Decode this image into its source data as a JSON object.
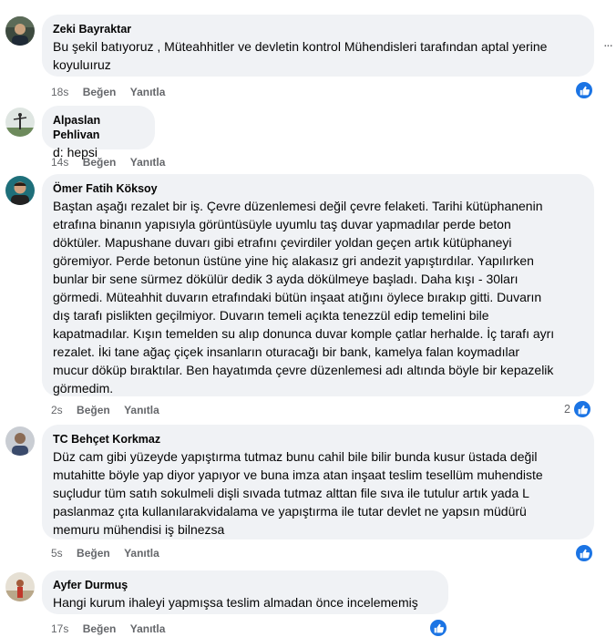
{
  "comments": [
    {
      "author": "Zeki Bayraktar",
      "lines": [
        "Bu şekil batıyoruz , Müteahhitler ve devletin kontrol Mühendisleri tarafından aptal yerine",
        "koyuluıruz"
      ],
      "time": "18s",
      "like_label": "Beğen",
      "reply_label": "Yanıtla",
      "reaction_count": ""
    },
    {
      "author": "Alpaslan Pehlivan",
      "lines": [
        "d: hepsi"
      ],
      "time": "14s",
      "like_label": "Beğen",
      "reply_label": "Yanıtla",
      "reaction_count": ""
    },
    {
      "author": "Ömer Fatih Köksoy",
      "lines": [
        "Baştan aşağı rezalet bir iş. Çevre düzenlemesi değil çevre felaketi. Tarihi kütüphanenin",
        "etrafına binanın yapısıyla görüntüsüyle uyumlu taş duvar yapmadılar perde beton",
        "döktüler. Mapushane duvarı gibi etrafını çevirdiler yoldan geçen artık kütüphaneyi",
        "göremiyor. Perde betonun üstüne yine hiç alakasız gri andezit yapıştırdılar. Yapılırken",
        "bunlar bir sene sürmez dökülür dedik 3 ayda dökülmeye başladı. Daha kışı - 30ları",
        "görmedi. Müteahhit duvarın etrafındaki bütün inşaat atığını öylece bırakıp gitti. Duvarın",
        "dış tarafı pislikten geçilmiyor. Duvarın temeli açıkta tenezzül edip temelini bile",
        "kapatmadılar. Kışın temelden su alıp donunca duvar komple çatlar herhalde. İç tarafı ayrı",
        "rezalet. İki tane ağaç çiçek insanların oturacağı bir bank, kamelya falan koymadılar",
        "mucur döküp bıraktılar. Ben hayatımda çevre düzenlemesi adı altında böyle bir kepazelik",
        "görmedim."
      ],
      "time": "2s",
      "like_label": "Beğen",
      "reply_label": "Yanıtla",
      "reaction_count": "2"
    },
    {
      "author": "TC Behçet Korkmaz",
      "lines": [
        "Düz cam gibi yüzeyde yapıştırma tutmaz bunu cahil bile bilir bunda kusur üstada değil",
        "mutahitte böyle yap diyor yapıyor ve buna imza atan inşaat teslim tesellüm muhendiste",
        "suçludur tüm satıh sokulmeli dişli sıvada tutmaz alttan file sıva ile tutulur artık yada L",
        "paslanmaz çıta kullanılarakvidalama ve yapıştırma ile tutar devlet ne yapsın müdürü",
        "memuru mühendisi iş bilnezsa"
      ],
      "time": "5s",
      "like_label": "Beğen",
      "reply_label": "Yanıtla",
      "reaction_count": ""
    },
    {
      "author": "Ayfer Durmuş",
      "lines": [
        "Hangi kurum ihaleyi yapmışsa teslim almadan önce incelememiş"
      ],
      "time": "17s",
      "like_label": "Beğen",
      "reply_label": "Yanıtla",
      "reaction_count": ""
    }
  ],
  "more_options_label": "...",
  "reaction_icon": "thumbs-up-icon",
  "colors": {
    "bubble_bg": "#f0f2f5",
    "meta_text": "#65676b",
    "like_blue": "#1b74e4"
  }
}
